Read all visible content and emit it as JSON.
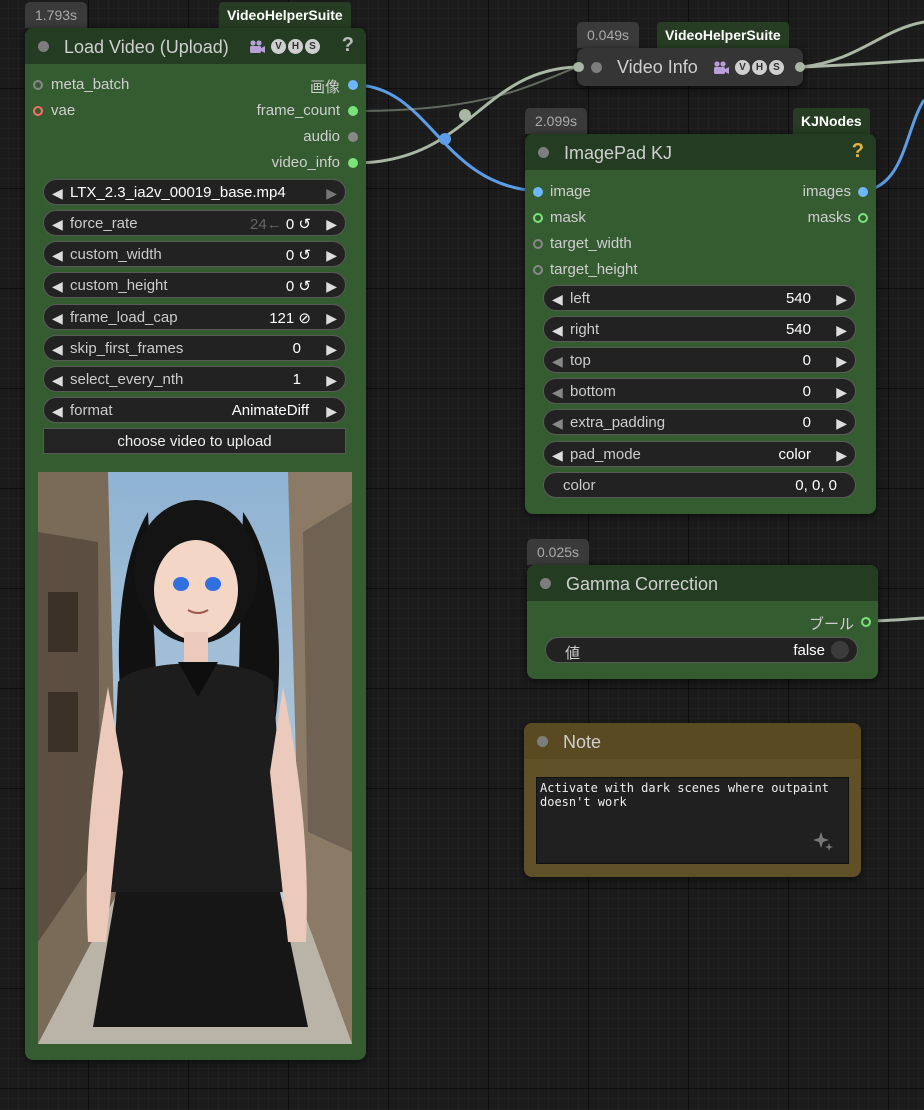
{
  "colors": {
    "node_body": "#355b31",
    "node_title": "#243d22",
    "note_body": "#5f5028",
    "wire_image": "#5b9de6",
    "wire_gray": "#a9b7a4",
    "dot_image": "#6eb6ff",
    "dot_latent": "#7be37b",
    "dot_vae": "#ff6e6e"
  },
  "load_video": {
    "timing": "1.793s",
    "badge": "VideoHelperSuite",
    "title": "Load Video (Upload)",
    "vhs_letters": [
      "V",
      "H",
      "S"
    ],
    "help": "?",
    "inputs": [
      {
        "label": "meta_batch",
        "color": "#888888"
      },
      {
        "label": "vae",
        "color": "#ff6e6e"
      }
    ],
    "outputs": [
      {
        "label": "画像",
        "color": "#6eb6ff"
      },
      {
        "label": "frame_count",
        "color": "#7be37b"
      },
      {
        "label": "audio",
        "color": "#888888"
      },
      {
        "label": "video_info",
        "color": "#7be37b"
      }
    ],
    "file": "LTX_2.3_ia2v_00019_base.mp4",
    "widgets": [
      {
        "label": "force_rate",
        "value": "0",
        "hint": "24←",
        "icon": "reset-icon"
      },
      {
        "label": "custom_width",
        "value": "0",
        "icon": "reset-icon"
      },
      {
        "label": "custom_height",
        "value": "0",
        "icon": "reset-icon"
      },
      {
        "label": "frame_load_cap",
        "value": "121",
        "icon": "disabled-icon"
      },
      {
        "label": "skip_first_frames",
        "value": "0"
      },
      {
        "label": "select_every_nth",
        "value": "1"
      },
      {
        "label": "format",
        "value": "AnimateDiff"
      }
    ],
    "upload_label": "choose video to upload"
  },
  "video_info": {
    "timing": "0.049s",
    "badge": "VideoHelperSuite",
    "title": "Video Info",
    "vhs_letters": [
      "V",
      "H",
      "S"
    ]
  },
  "imagepad": {
    "timing": "2.099s",
    "badge": "KJNodes",
    "title": "ImagePad KJ",
    "help": "?",
    "inputs": [
      {
        "label": "image",
        "color": "#6eb6ff"
      },
      {
        "label": "mask",
        "color": "#7be37b"
      },
      {
        "label": "target_width",
        "color": "#888888"
      },
      {
        "label": "target_height",
        "color": "#888888"
      }
    ],
    "outputs": [
      {
        "label": "images",
        "color": "#6eb6ff"
      },
      {
        "label": "masks",
        "color": "#7be37b"
      }
    ],
    "widgets": [
      {
        "label": "left",
        "value": "540",
        "dim": false
      },
      {
        "label": "right",
        "value": "540",
        "dim": false
      },
      {
        "label": "top",
        "value": "0",
        "dim": true
      },
      {
        "label": "bottom",
        "value": "0",
        "dim": true
      },
      {
        "label": "extra_padding",
        "value": "0",
        "dim": true
      },
      {
        "label": "pad_mode",
        "value": "color",
        "dim": false
      }
    ],
    "color_label": "color",
    "color_value": "0, 0, 0"
  },
  "gamma": {
    "timing": "0.025s",
    "title": "Gamma Correction",
    "output_label": "ブール",
    "widget_label": "値",
    "widget_value": "false"
  },
  "note": {
    "title": "Note",
    "text": "Activate with dark scenes where outpaint\ndoesn't work"
  }
}
